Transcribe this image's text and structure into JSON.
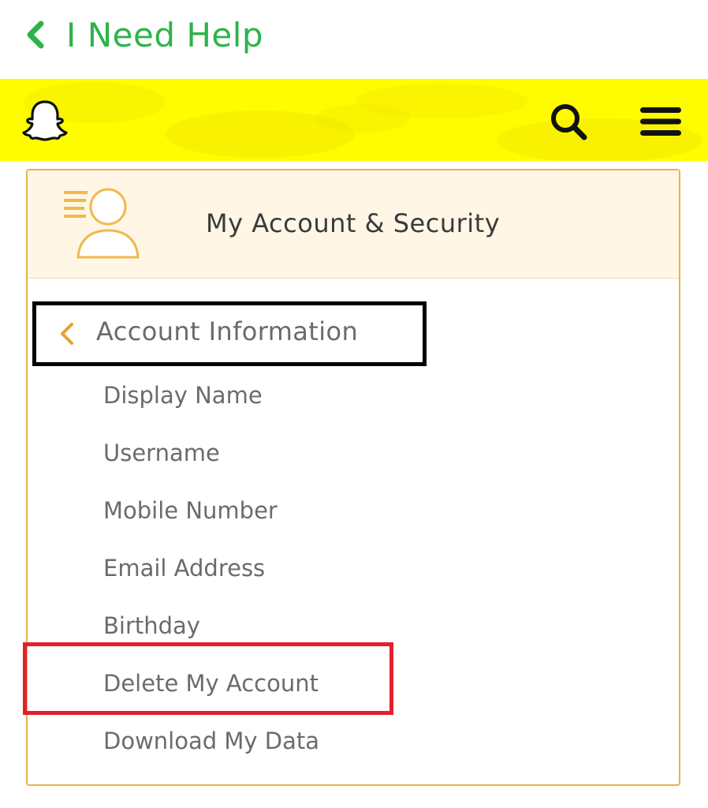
{
  "top_bar": {
    "title": "I Need Help"
  },
  "header": {
    "logo_icon": "snapchat-ghost-icon",
    "search_icon": "search-icon",
    "menu_icon": "hamburger-menu-icon",
    "background_color": "#fffc00"
  },
  "card": {
    "title": "My Account & Security",
    "icon": "account-profile-icon"
  },
  "section": {
    "title": "Account Information"
  },
  "menu_items": [
    {
      "label": "Display Name"
    },
    {
      "label": "Username"
    },
    {
      "label": "Mobile Number"
    },
    {
      "label": "Email Address"
    },
    {
      "label": "Birthday"
    },
    {
      "label": "Delete My Account"
    },
    {
      "label": "Download My Data"
    }
  ],
  "colors": {
    "accent_green": "#2db34a",
    "accent_orange": "#e6a12b",
    "highlight_red": "#e3202a",
    "highlight_black": "#000000"
  }
}
